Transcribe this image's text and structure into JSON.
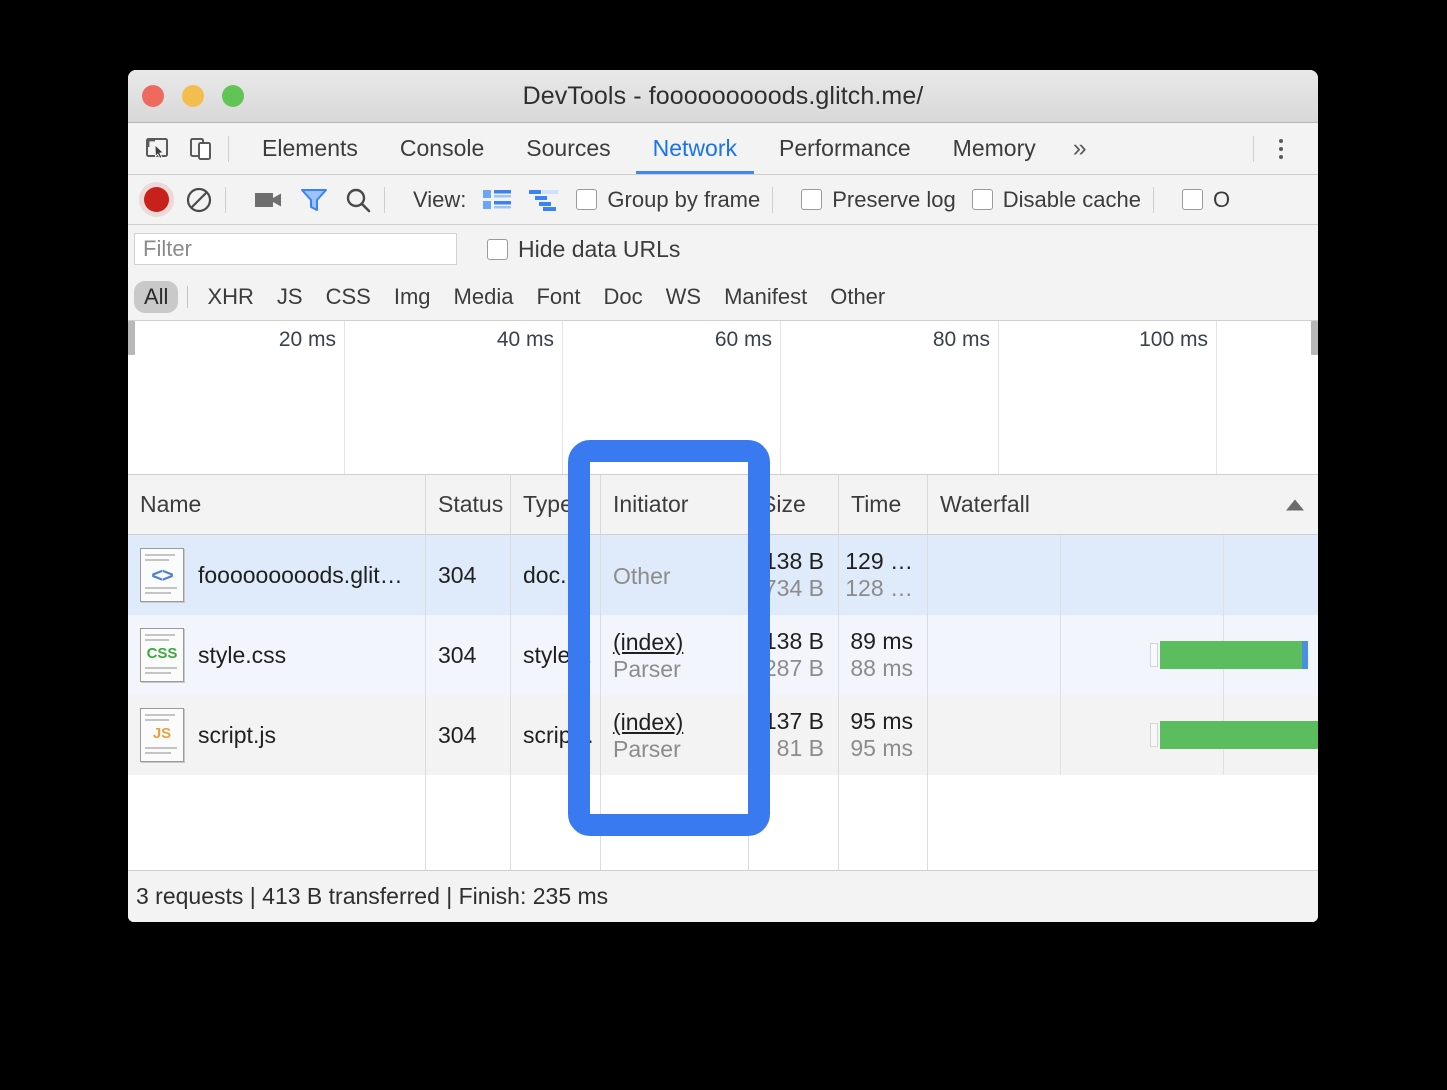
{
  "window": {
    "title": "DevTools - fooooooooods.glitch.me/",
    "traffic_lights": [
      "close-red",
      "minimize-yellow",
      "maximize-green"
    ]
  },
  "panel_tabs": {
    "items": [
      {
        "label": "Elements",
        "active": false
      },
      {
        "label": "Console",
        "active": false
      },
      {
        "label": "Sources",
        "active": false
      },
      {
        "label": "Network",
        "active": true
      },
      {
        "label": "Performance",
        "active": false
      },
      {
        "label": "Memory",
        "active": false
      }
    ],
    "more_label": "»",
    "left_icons": [
      "inspect-element-icon",
      "device-toolbar-icon"
    ],
    "menu_icon": "kebab-menu-icon"
  },
  "network_toolbar": {
    "icons": [
      "record-button",
      "clear-button",
      "capture-screenshots-icon",
      "filter-icon",
      "search-icon"
    ],
    "view_label": "View:",
    "view_icons": [
      "list-view-icon",
      "waterfall-view-icon"
    ],
    "checkboxes": [
      {
        "label": "Group by frame",
        "checked": false
      },
      {
        "label": "Preserve log",
        "checked": false
      },
      {
        "label": "Disable cache",
        "checked": false
      },
      {
        "label": "O",
        "checked": false
      }
    ]
  },
  "filter_row": {
    "placeholder": "Filter",
    "value": "",
    "hide_data_urls_label": "Hide data URLs",
    "hide_data_urls_checked": false
  },
  "type_filters": {
    "items": [
      {
        "label": "All",
        "selected": true
      },
      {
        "label": "XHR",
        "selected": false
      },
      {
        "label": "JS",
        "selected": false
      },
      {
        "label": "CSS",
        "selected": false
      },
      {
        "label": "Img",
        "selected": false
      },
      {
        "label": "Media",
        "selected": false
      },
      {
        "label": "Font",
        "selected": false
      },
      {
        "label": "Doc",
        "selected": false
      },
      {
        "label": "WS",
        "selected": false
      },
      {
        "label": "Manifest",
        "selected": false
      },
      {
        "label": "Other",
        "selected": false
      }
    ]
  },
  "overview": {
    "ticks": [
      "20 ms",
      "40 ms",
      "60 ms",
      "80 ms",
      "100 ms"
    ]
  },
  "table": {
    "headers": [
      "Name",
      "Status",
      "Type",
      "Initiator",
      "Size",
      "Time",
      "Waterfall"
    ],
    "sort_indicator": "ascending-arrow",
    "rows": [
      {
        "icon": "document-file-icon",
        "icon_badge": "<>",
        "name": "fooooooooods.glit…",
        "status": "304",
        "type": "doc.",
        "initiator_main": "Other",
        "initiator_sub": "",
        "size_main": "138 B",
        "size_sub": "734 B",
        "time_main": "129 …",
        "time_sub": "128 …",
        "selected": true,
        "waterfall_bar": false
      },
      {
        "icon": "css-file-icon",
        "icon_badge": "CSS",
        "name": "style.css",
        "status": "304",
        "type": "style…",
        "initiator_main": "(index)",
        "initiator_sub": "Parser",
        "size_main": "138 B",
        "size_sub": "287 B",
        "time_main": "89 ms",
        "time_sub": "88 ms",
        "selected": false,
        "waterfall_bar": true
      },
      {
        "icon": "js-file-icon",
        "icon_badge": "JS",
        "name": "script.js",
        "status": "304",
        "type": "scrip…",
        "initiator_main": "(index)",
        "initiator_sub": "Parser",
        "size_main": "137 B",
        "size_sub": "81 B",
        "time_main": "95 ms",
        "time_sub": "95 ms",
        "selected": false,
        "waterfall_bar": true
      }
    ]
  },
  "status_bar": {
    "text": "3 requests | 413 B transferred | Finish: 235 ms"
  },
  "callout": {
    "target": "initiator-column",
    "color": "#3a7af0"
  }
}
